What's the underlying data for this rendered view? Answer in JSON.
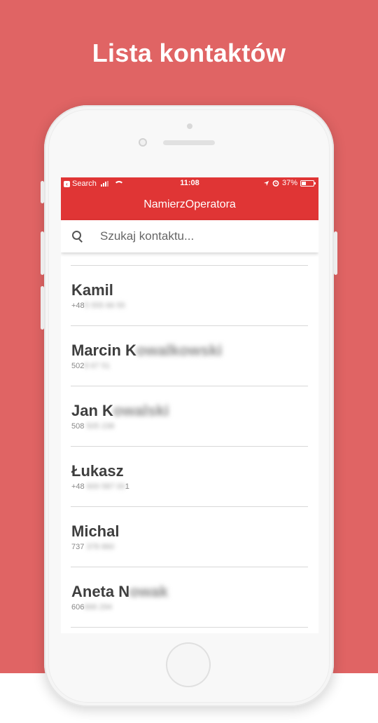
{
  "page_heading": "Lista kontaktów",
  "status_bar": {
    "back_app": "Search",
    "time": "11:08",
    "battery": "37%",
    "battery_level": 0.37
  },
  "app_title": "NamierzOperatora",
  "search": {
    "placeholder": "Szukaj kontaktu..."
  },
  "contacts": [
    {
      "name": "Kamil",
      "name_hidden": "",
      "phone": "+48",
      "phone_hidden": "5 555 66 55"
    },
    {
      "name": "Marcin K",
      "name_hidden": "owalkowski",
      "phone": "502",
      "phone_hidden": "8 67 51"
    },
    {
      "name": "Jan K",
      "name_hidden": "owalski",
      "phone": "508 ",
      "phone_hidden": "505 238"
    },
    {
      "name": "Łukasz",
      "name_hidden": "",
      "phone": "+48 ",
      "phone_hidden": "600 587 00",
      "phone_suffix": "1"
    },
    {
      "name": "Michal",
      "name_hidden": "",
      "phone": "737 ",
      "phone_hidden": "378 860"
    },
    {
      "name": "Aneta N",
      "name_hidden": "owak",
      "phone": "606",
      "phone_hidden": "666 294"
    }
  ],
  "colors": {
    "background": "#e06464",
    "primary": "#e03535",
    "text_dark": "#3e3e3e",
    "text_muted": "#888888"
  },
  "icons": [
    "back-icon",
    "signal-icon",
    "wifi-icon",
    "location-icon",
    "alarm-icon",
    "battery-icon",
    "search-icon"
  ]
}
